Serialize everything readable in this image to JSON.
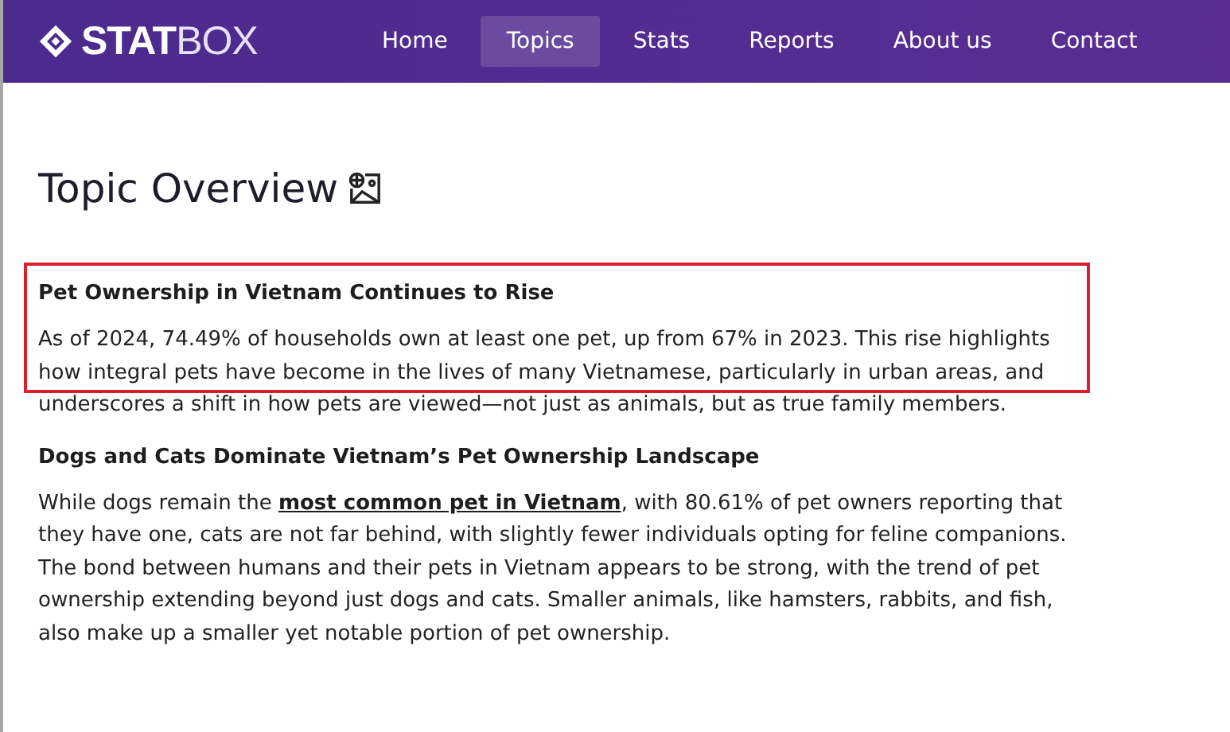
{
  "logo": {
    "bold": "STAT",
    "light": "BOX"
  },
  "nav": [
    {
      "label": "Home",
      "selected": false
    },
    {
      "label": "Topics",
      "selected": true
    },
    {
      "label": "Stats",
      "selected": false
    },
    {
      "label": "Reports",
      "selected": false
    },
    {
      "label": "About us",
      "selected": false
    },
    {
      "label": "Contact",
      "selected": false
    }
  ],
  "title": "Topic Overview",
  "sections": [
    {
      "heading": "Pet Ownership in Vietnam Continues to Rise",
      "highlighted": true,
      "paragraph": [
        {
          "text": "As of 2024, 74.49% of households own at least one pet, up from 67% in 2023. This rise highlights how integral pets have become in the lives of many Vietnamese, particularly in urban areas, and underscores a shift in how pets are viewed—not just as animals, but as true family members."
        }
      ]
    },
    {
      "heading": "Dogs and Cats Dominate Vietnam’s Pet Ownership Landscape",
      "highlighted": false,
      "paragraph": [
        {
          "text": "While dogs remain the "
        },
        {
          "text": "most common pet in Vietnam",
          "link": true
        },
        {
          "text": ", with 80.61% of pet owners reporting that they have one, cats are not far behind, with slightly fewer individuals opting for feline companions. The bond between humans and their pets in Vietnam appears to be strong, with the trend of pet ownership extending beyond just dogs and cats. Smaller animals, like hamsters, rabbits, and fish, also make up a smaller yet notable portion of pet ownership."
        }
      ]
    }
  ]
}
